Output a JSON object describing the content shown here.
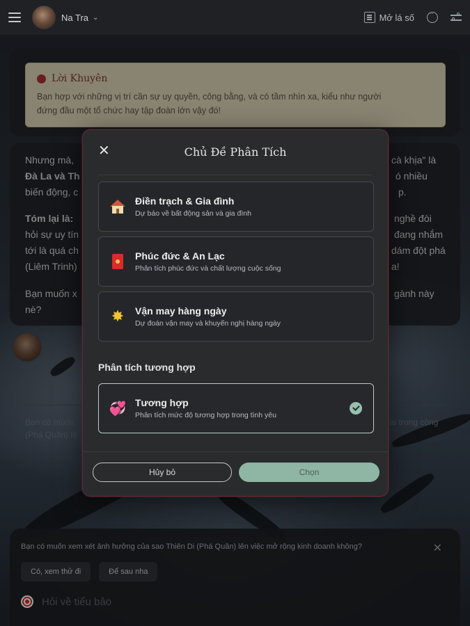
{
  "topbar": {
    "username": "Na Tra",
    "open_book_label": "Mở lá số"
  },
  "chat": {
    "advice_title": "Lời Khuyên",
    "advice_text_line1": "Bạn hợp với những vị trí cần sự uy quyền, công bằng, và có tầm nhìn xa, kiểu như người",
    "advice_text_line2": "đứng đầu một tổ chức hay tập đoàn lớn vậy đó!",
    "line1_left": "Nhưng mà,",
    "line1_right": "cà khịa\" là",
    "line2_left": "Đà La và Th",
    "line2_right": "ó nhiều",
    "line3_left": "biến động, c",
    "line3_right": "p.",
    "line4_left": "Tóm lại là:",
    "line4_right": "nghề đòi",
    "line5_left": "hỏi sự uy tín",
    "line5_right": "đang nhắm",
    "line6_left": "tới là quá ch",
    "line6_right": "dám đột phá",
    "line7_left": "(Liêm Trinh)",
    "line7_right": "a!",
    "line8_left": "Bạn muốn x",
    "line8_right": "gành này",
    "line9_left": "nè?",
    "ghost_left_1": "Bạn có muốn",
    "ghost_left_2": "(Phá Quân) lê",
    "ghost_right": "ai trong công"
  },
  "suggestion": {
    "question": "Bạn có muốn xem xét ảnh hưởng của sao Thiên Di (Phá Quân) lên việc mở rộng kinh doanh không?",
    "chip_yes": "Có, xem thử đi",
    "chip_later": "Để sau nha",
    "input_placeholder": "Hỏi về tiểu bảo"
  },
  "modal": {
    "title": "Chủ Đề Phân Tích",
    "options": [
      {
        "name": "Điền trạch & Gia đình",
        "desc": "Dự báo về bất động sản và gia đình",
        "icon": "house-icon"
      },
      {
        "name": "Phúc đức & An Lạc",
        "desc": "Phân tích phúc đức và chất lượng cuộc sống",
        "icon": "red-envelope-icon"
      },
      {
        "name": "Vận may hàng ngày",
        "desc": "Dự đoán vận may và khuyến nghị hàng ngày",
        "icon": "star-icon"
      }
    ],
    "section_label": "Phân tích tương hợp",
    "compat": {
      "name": "Tương hợp",
      "desc": "Phân tích mức độ tương hợp trong tình yêu",
      "icon": "hearts-icon",
      "selected": true
    },
    "cancel_label": "Hủy bỏ",
    "choose_label": "Chọn"
  },
  "colors": {
    "accent_green": "#8fb5a4",
    "modal_border": "#5e2b33",
    "advice_bg": "#ddd3b8"
  }
}
